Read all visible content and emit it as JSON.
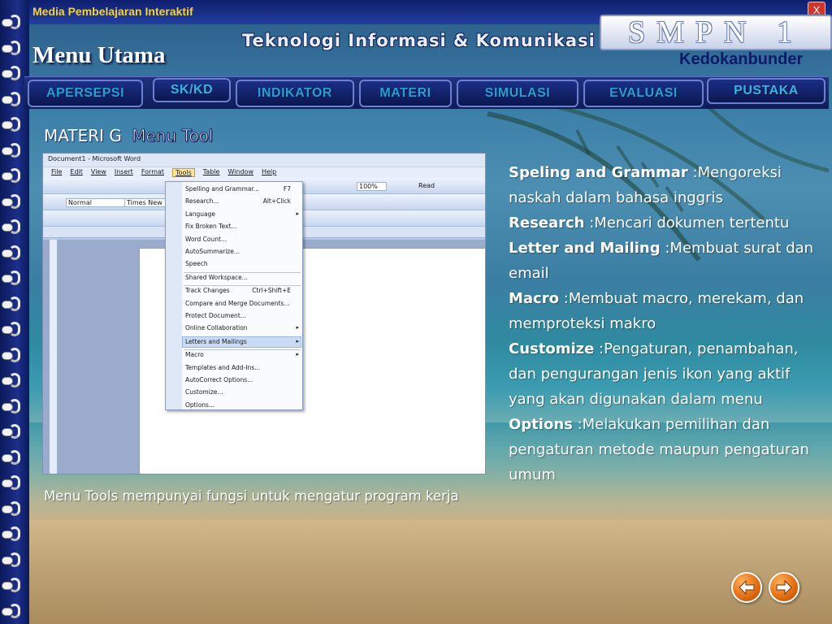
{
  "header": {
    "media_title": "Media Pembelajaran Interaktif",
    "menu_utama": "Menu Utama",
    "tik_title": "Teknologi Informasi & Komunikasi",
    "school_name": "SMPN 1",
    "school_place": "Kedokanbunder",
    "close_label": "X"
  },
  "nav": {
    "items": [
      {
        "label": "APERSEPSI"
      },
      {
        "label": "SK/KD"
      },
      {
        "label": "INDIKATOR"
      },
      {
        "label": "MATERI"
      },
      {
        "label": "SIMULASI"
      },
      {
        "label": "EVALUASI"
      },
      {
        "label": "PUSTAKA"
      }
    ]
  },
  "content": {
    "heading": "MATERI  G",
    "heading_sub": "Menu Tool",
    "caption": "Menu Tools mempunyai fungsi untuk mengatur program kerja",
    "descriptions": [
      {
        "term": "Speling and Grammar",
        "text": " :Mengoreksi naskah dalam bahasa inggris"
      },
      {
        "term": "Research",
        "text": " :Mencari dokumen tertentu"
      },
      {
        "term": "Letter and Mailing",
        "text": " :Membuat surat dan email"
      },
      {
        "term": "Macro",
        "text": " :Membuat macro, merekam, dan memproteksi makro"
      },
      {
        "term": "Customize",
        "text": " :Pengaturan, penambahan, dan pengurangan jenis ikon  yang aktif yang akan digunakan dalam menu"
      },
      {
        "term": "Options",
        "text": " :Melakukan pemilihan dan pengaturan metode maupun pengaturan umum"
      }
    ]
  },
  "word_screenshot": {
    "window_title": "Document1 - Microsoft Word",
    "menubar": [
      "File",
      "Edit",
      "View",
      "Insert",
      "Format",
      "Tools",
      "Table",
      "Window",
      "Help"
    ],
    "style_box": "Normal",
    "font_box": "Times New R",
    "zoom": "100%",
    "read_button": "Read",
    "tools_menu": [
      {
        "label": "Spelling and Grammar...",
        "key": "F7"
      },
      {
        "label": "Research...",
        "key": "Alt+Click"
      },
      {
        "label": "Language",
        "key": "▸"
      },
      {
        "label": "Fix Broken Text...",
        "key": ""
      },
      {
        "label": "Word Count...",
        "key": ""
      },
      {
        "label": "AutoSummarize...",
        "key": ""
      },
      {
        "label": "Speech",
        "key": ""
      },
      {
        "label": "Shared Workspace...",
        "key": ""
      },
      {
        "label": "Track Changes",
        "key": "Ctrl+Shift+E"
      },
      {
        "label": "Compare and Merge Documents...",
        "key": ""
      },
      {
        "label": "Protect Document...",
        "key": ""
      },
      {
        "label": "Online Collaboration",
        "key": "▸"
      },
      {
        "label": "Letters and Mailings",
        "key": "▸"
      },
      {
        "label": "Macro",
        "key": "▸"
      },
      {
        "label": "Templates and Add-Ins...",
        "key": ""
      },
      {
        "label": "AutoCorrect Options...",
        "key": ""
      },
      {
        "label": "Customize...",
        "key": ""
      },
      {
        "label": "Options...",
        "key": ""
      }
    ]
  },
  "controls": {
    "prev_icon": "arrow-left-icon",
    "next_icon": "arrow-right-icon"
  },
  "colors": {
    "nav_text": "#20a2d8",
    "title_yellow": "#f4d23a",
    "arrow_orange": "#e06a10"
  }
}
